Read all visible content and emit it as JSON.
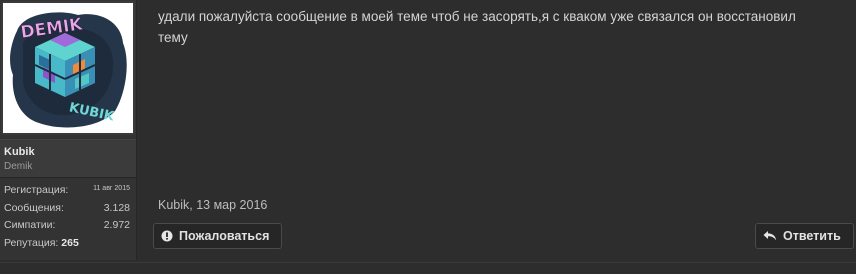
{
  "post": {
    "message": "удали пожалуйста сообщение в моей теме чтоб не засорять,я с кваком уже связался он восстановил тему",
    "meta": "Kubik, 13 мар 2016",
    "report_label": "Пожаловаться",
    "reply_label": "Ответить"
  },
  "user": {
    "avatar_icon": "demik-kubik-logo",
    "avatar_logo_top": "DEMIK",
    "avatar_logo_bottom": "KUBIK",
    "name": "Kubik",
    "title": "Demik",
    "stats": {
      "registration_label": "Регистрация:",
      "registration_value": "11 авг 2015",
      "messages_label": "Сообщения:",
      "messages_value": "3.128",
      "likes_label": "Симпатии:",
      "likes_value": "2.972",
      "reputation_label": "Репутация:",
      "reputation_value": "265"
    }
  },
  "colors": {
    "background": "#2d2d2d",
    "sidebar": "#333333",
    "button_bg": "#262626"
  }
}
